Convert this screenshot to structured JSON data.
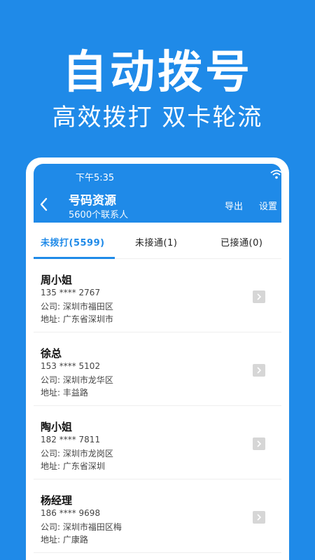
{
  "promo": {
    "title": "自动拨号",
    "subtitle": "高效拨打 双卡轮流"
  },
  "status_bar": {
    "time": "下午5:35"
  },
  "header": {
    "title": "号码资源",
    "subtitle": "5600个联系人",
    "export_label": "导出",
    "settings_label": "设置"
  },
  "tabs": [
    {
      "label": "未拨打(5599)",
      "active": true
    },
    {
      "label": "未接通(1)",
      "active": false
    },
    {
      "label": "已接通(0)",
      "active": false
    }
  ],
  "contacts": [
    {
      "name": "周小姐",
      "phone": "135 **** 2767",
      "company": "公司: 深圳市福田区",
      "address": "地址: 广东省深圳市"
    },
    {
      "name": "徐总",
      "phone": "153 **** 5102",
      "company": "公司: 深圳市龙华区",
      "address": "地址: 丰益路"
    },
    {
      "name": "陶小姐",
      "phone": "182 **** 7811",
      "company": "公司: 深圳市龙岗区",
      "address": "地址: 广东省深圳"
    },
    {
      "name": "杨经理",
      "phone": "186 **** 9698",
      "company": "公司: 深圳市福田区梅",
      "address": "地址: 广康路"
    }
  ],
  "colors": {
    "brand": "#1f8ae8",
    "divider": "#eeeeee",
    "chevron_bg": "#d6d6d6"
  },
  "icons": [
    "wifi-icon",
    "back-icon",
    "chevron-right-icon"
  ]
}
